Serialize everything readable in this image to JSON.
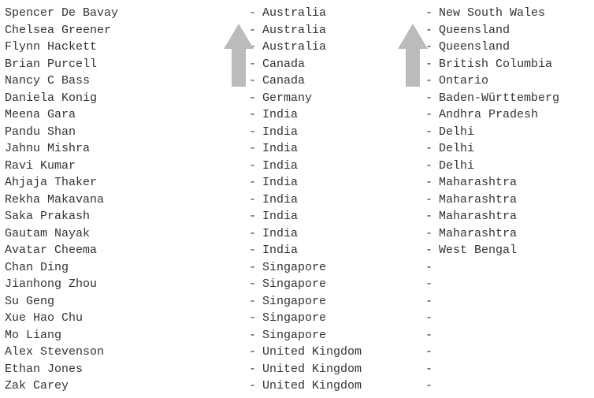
{
  "rows": [
    {
      "name": "Spencer De Bavay",
      "country": "Australia",
      "state": "New South Wales"
    },
    {
      "name": "Chelsea Greener",
      "country": "Australia",
      "state": "Queensland"
    },
    {
      "name": "Flynn Hackett",
      "country": "Australia",
      "state": "Queensland"
    },
    {
      "name": "Brian Purcell",
      "country": "Canada",
      "state": "British Columbia"
    },
    {
      "name": "Nancy C Bass",
      "country": "Canada",
      "state": "Ontario"
    },
    {
      "name": "Daniela Konig",
      "country": "Germany",
      "state": "Baden-Württemberg"
    },
    {
      "name": "Meena Gara",
      "country": "India",
      "state": "Andhra Pradesh"
    },
    {
      "name": "Pandu Shan",
      "country": "India",
      "state": "Delhi"
    },
    {
      "name": "Jahnu Mishra",
      "country": "India",
      "state": "Delhi"
    },
    {
      "name": "Ravi Kumar",
      "country": "India",
      "state": "Delhi"
    },
    {
      "name": "Ahjaja Thaker",
      "country": "India",
      "state": "Maharashtra"
    },
    {
      "name": "Rekha Makavana",
      "country": "India",
      "state": "Maharashtra"
    },
    {
      "name": "Saka Prakash",
      "country": "India",
      "state": "Maharashtra"
    },
    {
      "name": "Gautam Nayak",
      "country": "India",
      "state": "Maharashtra"
    },
    {
      "name": "Avatar Cheema",
      "country": "India",
      "state": "West Bengal"
    },
    {
      "name": "Chan Ding",
      "country": "Singapore",
      "state": ""
    },
    {
      "name": "Jianhong Zhou",
      "country": "Singapore",
      "state": ""
    },
    {
      "name": "Su Geng",
      "country": "Singapore",
      "state": ""
    },
    {
      "name": "Xue Hao Chu",
      "country": "Singapore",
      "state": ""
    },
    {
      "name": "Mo Liang",
      "country": "Singapore",
      "state": ""
    },
    {
      "name": "Alex Stevenson",
      "country": "United Kingdom",
      "state": ""
    },
    {
      "name": "Ethan Jones",
      "country": "United Kingdom",
      "state": ""
    },
    {
      "name": "Zak Carey",
      "country": "United Kingdom",
      "state": ""
    }
  ],
  "dash": "-",
  "arrows": {
    "sort_country": "ascending",
    "sort_state": "ascending"
  }
}
